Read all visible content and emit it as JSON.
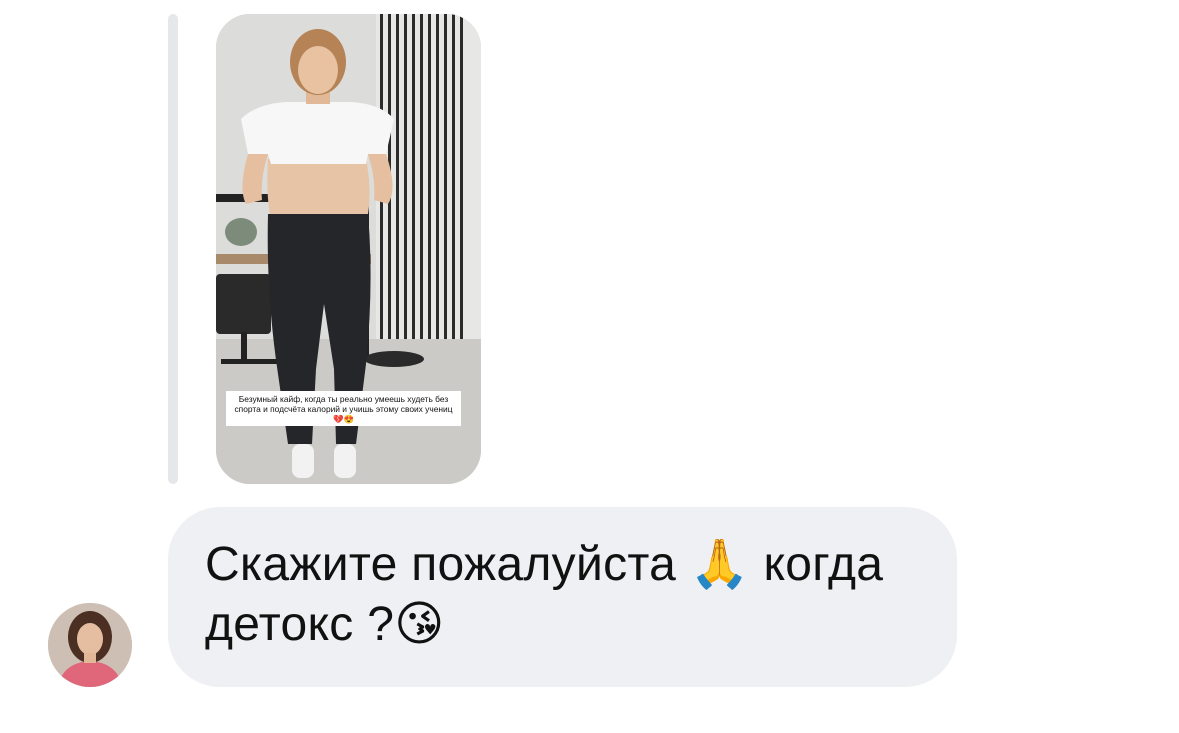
{
  "reply_preview": {
    "caption": "Безумный кайф, когда ты реально умеешь худеть без спорта и подсчёта калорий и учишь этому своих учениц💔😍"
  },
  "message": {
    "text": "Скажите пожалуйста 🙏 когда детокс ?😘"
  },
  "sender": {
    "avatar_label": "avatar"
  }
}
